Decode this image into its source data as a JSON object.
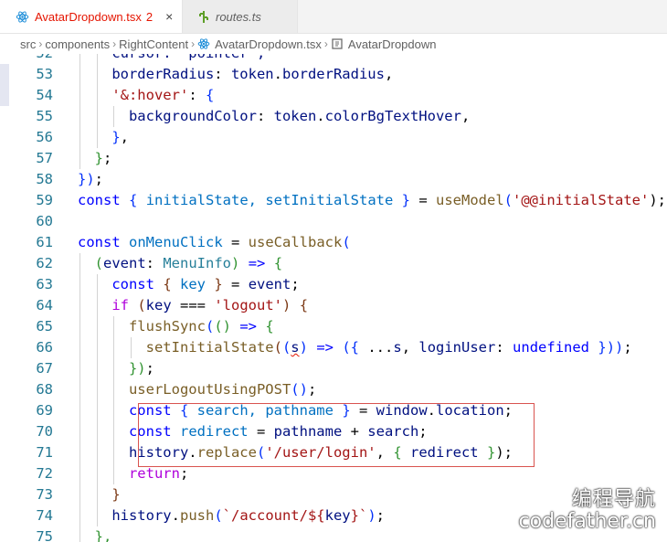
{
  "tabs": [
    {
      "name": "AvatarDropdown.tsx",
      "badge": "2",
      "close": "×",
      "icon": "react-icon",
      "active": true
    },
    {
      "name": "routes.ts",
      "icon": "typescript-config-icon",
      "active": false
    }
  ],
  "breadcrumb": [
    "src",
    "components",
    "RightContent",
    "AvatarDropdown.tsx",
    "AvatarDropdown"
  ],
  "lines": [
    {
      "n": "52",
      "indent": 2,
      "tokens": [
        [
          "cursor: 'pointer',",
          "#001080"
        ]
      ]
    },
    {
      "n": "53",
      "indent": 2,
      "tokens": [
        [
          "borderRadius",
          "#001080"
        ],
        [
          ": ",
          "#000000"
        ],
        [
          "token",
          "#001080"
        ],
        [
          ".",
          "#000000"
        ],
        [
          "borderRadius",
          "#001080"
        ],
        [
          ",",
          "#000000"
        ]
      ]
    },
    {
      "n": "54",
      "indent": 2,
      "tokens": [
        [
          "'&:hover'",
          "#a31515"
        ],
        [
          ": ",
          "#000000"
        ],
        [
          "{",
          "#0431fa"
        ]
      ]
    },
    {
      "n": "55",
      "indent": 3,
      "tokens": [
        [
          "backgroundColor",
          "#001080"
        ],
        [
          ": ",
          "#000000"
        ],
        [
          "token",
          "#001080"
        ],
        [
          ".",
          "#000000"
        ],
        [
          "colorBgTextHover",
          "#001080"
        ],
        [
          ",",
          "#000000"
        ]
      ]
    },
    {
      "n": "56",
      "indent": 2,
      "tokens": [
        [
          "}",
          "#0431fa"
        ],
        [
          ",",
          "#000000"
        ]
      ]
    },
    {
      "n": "57",
      "indent": 1,
      "tokens": [
        [
          "}",
          "#319331"
        ],
        [
          ";",
          "#000000"
        ]
      ]
    },
    {
      "n": "58",
      "indent": 0,
      "tokens": [
        [
          "})",
          "#0431fa"
        ],
        [
          ";",
          "#000000"
        ]
      ]
    },
    {
      "n": "59",
      "indent": 0,
      "tokens": [
        [
          "const",
          "#0000ff"
        ],
        [
          " ",
          "#000000"
        ],
        [
          "{",
          "#0431fa"
        ],
        [
          " initialState, setInitialState ",
          "#0070c1"
        ],
        [
          "}",
          "#0431fa"
        ],
        [
          " = ",
          "#000000"
        ],
        [
          "useModel",
          "#795e26"
        ],
        [
          "(",
          "#0431fa"
        ],
        [
          "'@@initialState'",
          "#a31515"
        ],
        [
          ");",
          "#000000"
        ]
      ]
    },
    {
      "n": "60",
      "indent": 0,
      "tokens": []
    },
    {
      "n": "61",
      "indent": 0,
      "tokens": [
        [
          "const",
          "#0000ff"
        ],
        [
          " ",
          "#000000"
        ],
        [
          "onMenuClick",
          "#0070c1"
        ],
        [
          " = ",
          "#000000"
        ],
        [
          "useCallback",
          "#795e26"
        ],
        [
          "(",
          "#0431fa"
        ]
      ]
    },
    {
      "n": "62",
      "indent": 1,
      "tokens": [
        [
          "(",
          "#319331"
        ],
        [
          "event",
          "#001080"
        ],
        [
          ": ",
          "#000000"
        ],
        [
          "MenuInfo",
          "#267f99"
        ],
        [
          ")",
          "#319331"
        ],
        [
          " ",
          "#000000"
        ],
        [
          "=>",
          "#0000ff"
        ],
        [
          " ",
          "#000000"
        ],
        [
          "{",
          "#319331"
        ]
      ]
    },
    {
      "n": "63",
      "indent": 2,
      "tokens": [
        [
          "const",
          "#0000ff"
        ],
        [
          " ",
          "#000000"
        ],
        [
          "{",
          "#7b3814"
        ],
        [
          " key ",
          "#0070c1"
        ],
        [
          "}",
          "#7b3814"
        ],
        [
          " = ",
          "#000000"
        ],
        [
          "event",
          "#001080"
        ],
        [
          ";",
          "#000000"
        ]
      ]
    },
    {
      "n": "64",
      "indent": 2,
      "tokens": [
        [
          "if",
          "#af00db"
        ],
        [
          " ",
          "#000000"
        ],
        [
          "(",
          "#7b3814"
        ],
        [
          "key",
          "#001080"
        ],
        [
          " === ",
          "#000000"
        ],
        [
          "'logout'",
          "#a31515"
        ],
        [
          ")",
          "#7b3814"
        ],
        [
          " ",
          "#000000"
        ],
        [
          "{",
          "#7b3814"
        ]
      ]
    },
    {
      "n": "65",
      "indent": 3,
      "tokens": [
        [
          "flushSync",
          "#795e26"
        ],
        [
          "(",
          "#0431fa"
        ],
        [
          "()",
          "#319331"
        ],
        [
          " ",
          "#000000"
        ],
        [
          "=>",
          "#0000ff"
        ],
        [
          " ",
          "#000000"
        ],
        [
          "{",
          "#319331"
        ]
      ]
    },
    {
      "n": "66",
      "indent": 4,
      "tokens": [
        [
          "setInitialState",
          "#795e26"
        ],
        [
          "(",
          "#7b3814"
        ],
        [
          "(",
          "#0431fa"
        ],
        [
          "s",
          "#001080",
          "squiggle"
        ],
        [
          ")",
          "#0431fa"
        ],
        [
          " ",
          "#000000"
        ],
        [
          "=>",
          "#0000ff"
        ],
        [
          " ",
          "#000000"
        ],
        [
          "({",
          "#0431fa"
        ],
        [
          " ...",
          "#000000"
        ],
        [
          "s",
          "#001080"
        ],
        [
          ", ",
          "#000000"
        ],
        [
          "loginUser",
          "#001080"
        ],
        [
          ": ",
          "#000000"
        ],
        [
          "undefined",
          "#0000ff"
        ],
        [
          " ",
          "#000000"
        ],
        [
          "}))",
          "#0431fa"
        ],
        [
          ";",
          "#000000"
        ]
      ]
    },
    {
      "n": "67",
      "indent": 3,
      "tokens": [
        [
          "})",
          "#319331"
        ],
        [
          ";",
          "#000000"
        ]
      ]
    },
    {
      "n": "68",
      "indent": 3,
      "tokens": [
        [
          "userLogoutUsingPOST",
          "#795e26"
        ],
        [
          "()",
          "#0431fa"
        ],
        [
          ";",
          "#000000"
        ]
      ]
    },
    {
      "n": "69",
      "indent": 3,
      "tokens": [
        [
          "const",
          "#0000ff"
        ],
        [
          " ",
          "#000000"
        ],
        [
          "{",
          "#0431fa"
        ],
        [
          " search, pathname ",
          "#0070c1"
        ],
        [
          "}",
          "#0431fa"
        ],
        [
          " = ",
          "#000000"
        ],
        [
          "window",
          "#001080"
        ],
        [
          ".",
          "#000000"
        ],
        [
          "location",
          "#001080"
        ],
        [
          ";",
          "#000000"
        ]
      ]
    },
    {
      "n": "70",
      "indent": 3,
      "tokens": [
        [
          "const",
          "#0000ff"
        ],
        [
          " ",
          "#000000"
        ],
        [
          "redirect",
          "#0070c1"
        ],
        [
          " = ",
          "#000000"
        ],
        [
          "pathname",
          "#001080"
        ],
        [
          " + ",
          "#000000"
        ],
        [
          "search",
          "#001080"
        ],
        [
          ";",
          "#000000"
        ]
      ]
    },
    {
      "n": "71",
      "indent": 3,
      "tokens": [
        [
          "history",
          "#001080"
        ],
        [
          ".",
          "#000000"
        ],
        [
          "replace",
          "#795e26"
        ],
        [
          "(",
          "#0431fa"
        ],
        [
          "'/user/login'",
          "#a31515"
        ],
        [
          ", ",
          "#000000"
        ],
        [
          "{",
          "#319331"
        ],
        [
          " redirect ",
          "#001080"
        ],
        [
          "}",
          "#319331"
        ],
        [
          ");",
          "#000000"
        ]
      ]
    },
    {
      "n": "72",
      "indent": 3,
      "tokens": [
        [
          "return",
          "#af00db"
        ],
        [
          ";",
          "#000000"
        ]
      ]
    },
    {
      "n": "73",
      "indent": 2,
      "tokens": [
        [
          "}",
          "#7b3814"
        ]
      ]
    },
    {
      "n": "74",
      "indent": 2,
      "tokens": [
        [
          "history",
          "#001080"
        ],
        [
          ".",
          "#000000"
        ],
        [
          "push",
          "#795e26"
        ],
        [
          "(",
          "#0431fa"
        ],
        [
          "`/account/${",
          "#a31515"
        ],
        [
          "key",
          "#001080"
        ],
        [
          "}`",
          "#a31515"
        ],
        [
          ")",
          "#0431fa"
        ],
        [
          ";",
          "#000000"
        ]
      ]
    },
    {
      "n": "75",
      "indent": 1,
      "tokens": [
        [
          "},",
          "#319331"
        ]
      ]
    }
  ],
  "watermark": {
    "line1": "编程导航",
    "line2": "codefather.cn"
  },
  "colors": {
    "line_number": "#237893",
    "highlight_border": "#d9534f",
    "modified_tab": "#e51400"
  }
}
